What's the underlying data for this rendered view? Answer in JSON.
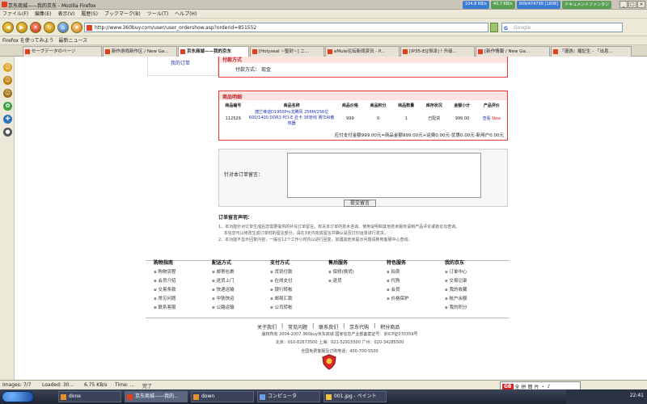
{
  "window": {
    "title": "京东商城——我的京东 - Mozilla Firefox",
    "sys": [
      "104.8 KB/s",
      "40.7 KB/s",
      "909/474799 [1806]",
      "ドキュメントファンタジ"
    ],
    "controls": [
      "_",
      "□",
      "×"
    ]
  },
  "menu": [
    "ファイル(F)",
    "編集(E)",
    "表示(V)",
    "履歴(S)",
    "ブックマーク(B)",
    "ツール(T)",
    "ヘルプ(H)"
  ],
  "nav": {
    "url": "http://www.360buy.com/user/user_ordershow.asp?orderid=851552",
    "search_placeholder": "Google",
    "search_logo": "G"
  },
  "bookmarks": [
    "Firefox を使ってみよう",
    "最新ニュース"
  ],
  "tabs": [
    "セーブデータのページ",
    "新作游戏新作区 / New Ga...",
    "京东商城——我的京东",
    "[Holyseal ~聖封~] ニ...",
    "eMule论坛新闻资讯 - P...",
    "[IP35-E][恒泽] ! 升级...",
    "[新作情報 / New Ga...",
    "『漫游』羅記生 - 「出息..."
  ],
  "side_icons": [
    "☺",
    "☺",
    "☺",
    "✿",
    "✚",
    "●"
  ],
  "left_link": "我的订单",
  "payment": {
    "heading": "付款方式",
    "label": "付款方式：",
    "value": "现金"
  },
  "items": {
    "heading": "商品明细",
    "columns": [
      "商品编号",
      "商品名称",
      "商品价格",
      "商品积分",
      "商品数量",
      "库存状况",
      "金额小计",
      "产品评价"
    ],
    "row": {
      "id": "112529",
      "name": "捷兰维迪D1950Pro龙腾风 256M/256位 600/1400 DDR3 PCI-E 显卡 36管线 赛华AI散热器",
      "price": "999",
      "points": "0",
      "qty": "1",
      "stock": "已配货",
      "subtotal": "999.00",
      "review": "查看",
      "badge": "New"
    },
    "summary": "应付支付金额999.00元=商品金额999.00元+运费0.00元-优惠0.00元-新用户0.00元"
  },
  "comment": {
    "label": "针对本订单留言：",
    "button": "提交留言"
  },
  "notice": {
    "title": "订单留言声明：",
    "lines": [
      "1、本功能针对订单生成后您需要提供的补充订单留言。有关本订单的技术咨询、使用说明和其他技术服务请到产品评论或者论坛查询。",
      "　 本信息可以修改生成订单时的留言部分，请在3天内完成留言并确认是否打印运单进行发货。",
      "2、本功能不显示回复内容，一般在12个工作小时内以进行回复，如遇其他未提示问题请致电客服中心查询。"
    ]
  },
  "footer": {
    "cols": [
      {
        "title": "购物指南",
        "items": [
          "购物流程",
          "会员介绍",
          "交易条款",
          "常见问题",
          "联系客服"
        ]
      },
      {
        "title": "配送方式",
        "items": [
          "邮寄包裹",
          "送货上门",
          "快递运输",
          "中铁快运",
          "公路运输"
        ]
      },
      {
        "title": "支付方式",
        "items": [
          "货到付款",
          "在线支付",
          "银行转帐",
          "邮局汇款",
          "公司转帐"
        ]
      },
      {
        "title": "售后服务",
        "items": [
          "保修(换货)",
          "退货"
        ]
      },
      {
        "title": "特色服务",
        "items": [
          "拍卖",
          "代购",
          "会员",
          "价格保护"
        ]
      },
      {
        "title": "我的京东",
        "items": [
          "订单中心",
          "交易记录",
          "我的收藏",
          "帐户余额",
          "我的积分"
        ]
      }
    ],
    "links": [
      "关于我们",
      "常见问题",
      "联系我们",
      "京东代购",
      "积分商品"
    ],
    "copyright": "版权所有 2004-2007 360buy京东商城 国家信息产业部备案证号：京ICP证070359号",
    "phones": "北京：010-82673500  上海：021-52915500  广州：020-34285500",
    "hotline": "全国免费客服及订购电话：400-700-5500"
  },
  "status": {
    "images": "Images: 7/7",
    "loaded": "Loaded: 30...",
    "speed": "6.75 KB/s",
    "time": "Time: ...",
    "done": "完了"
  },
  "ime": {
    "badge": "GB",
    "labels": [
      "全",
      "拼",
      "簡",
      "片",
      "・",
      "♪"
    ]
  },
  "taskbar": {
    "tasks": [
      "done",
      "京东商城——我的...",
      "down",
      "コンピュータ",
      "001.jpg - ペイント"
    ],
    "clock": "22:41"
  }
}
